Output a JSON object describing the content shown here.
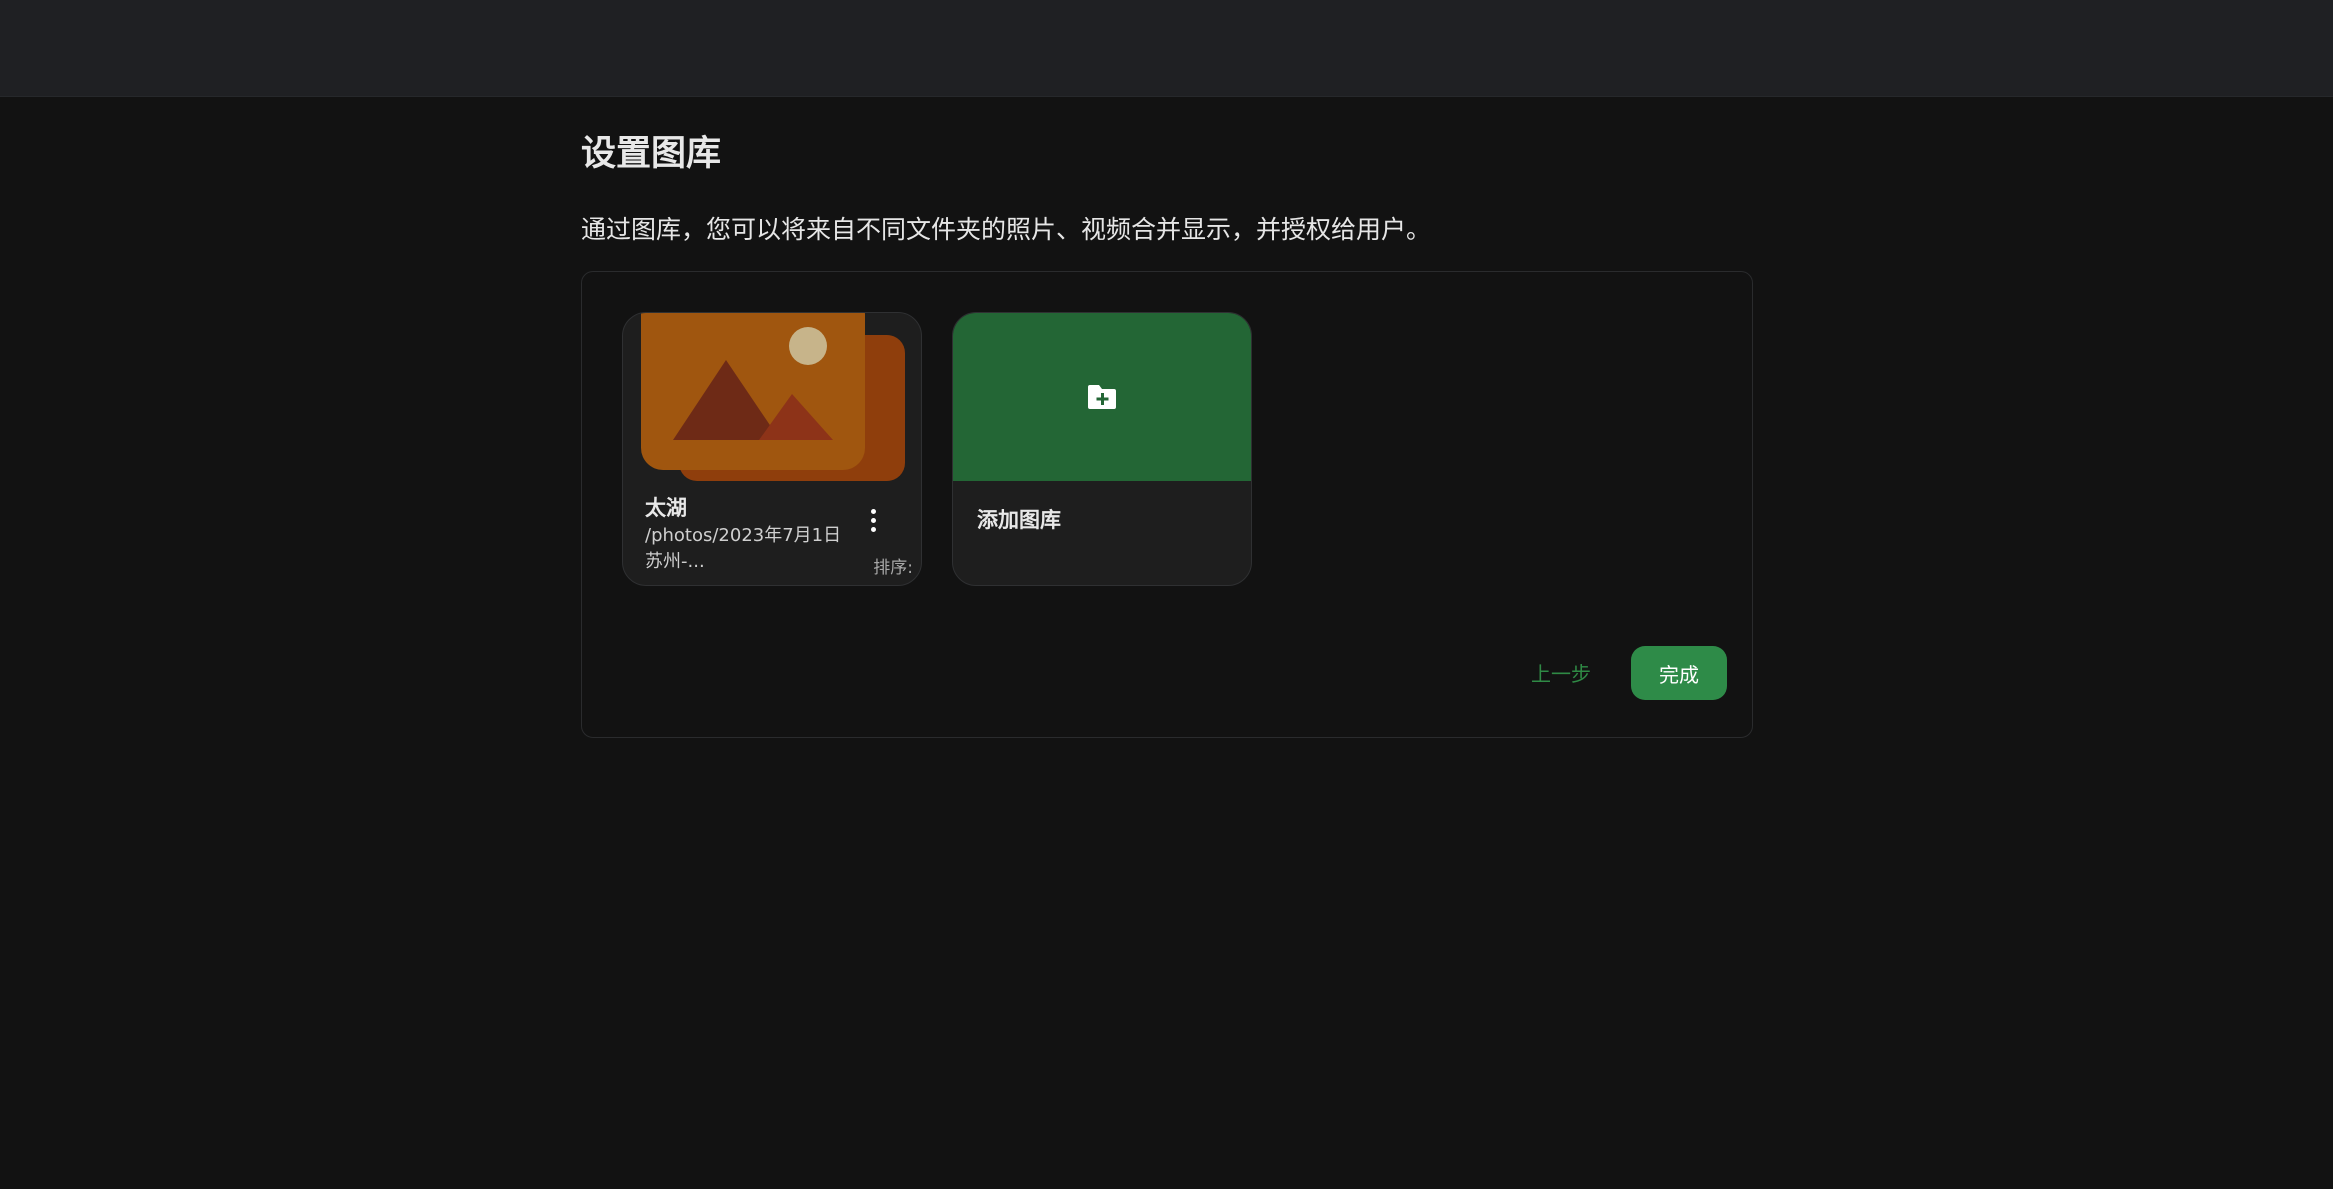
{
  "page": {
    "title": "设置图库",
    "description": "通过图库，您可以将来自不同文件夹的照片、视频合并显示，并授权给用户。"
  },
  "libraries": [
    {
      "name": "太湖",
      "path": "/photos/2023年7月1日",
      "description": "苏州-...",
      "sort_label": "排序:",
      "thumbnail_icon": "image-placeholder-icon",
      "more_icon": "more-vertical-icon"
    }
  ],
  "add_library": {
    "label": "添加图库",
    "icon": "folder-plus-icon"
  },
  "actions": {
    "prev_label": "上一步",
    "done_label": "完成"
  },
  "colors": {
    "accent": "#2e8b48",
    "add_card_bg": "#236635",
    "thumb_front": "#a0560f",
    "thumb_back": "#8f3e0c"
  }
}
